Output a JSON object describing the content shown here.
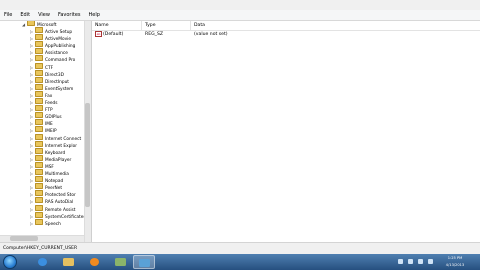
{
  "menu": [
    "File",
    "Edit",
    "View",
    "Favorites",
    "Help"
  ],
  "tree": {
    "root": "Microsoft",
    "items": [
      "Active Setup",
      "ActiveMovie",
      "AppPublishing",
      "Assistance",
      "Command Pro",
      "CTF",
      "Direct3D",
      "DirectInput",
      "EventSystem",
      "Fax",
      "Feeds",
      "FTP",
      "GDIPlus",
      "IME",
      "IMEIP",
      "Internet Connect",
      "Internet Explor",
      "Keyboard",
      "MediaPlayer",
      "MSF",
      "Multimedia",
      "Notepad",
      "PeerNet",
      "Protected Stor",
      "RAS AutoDial",
      "Remote Assist",
      "SystemCertificates",
      "Speech"
    ]
  },
  "list": {
    "columns": [
      "Name",
      "Type",
      "Data"
    ],
    "rows": [
      {
        "name": "(Default)",
        "type": "REG_SZ",
        "data": "(value not set)"
      }
    ]
  },
  "status": "Computer\\HKEY_CURRENT_USER",
  "clock": {
    "time": "1:25 PM",
    "date": "4/13/2013"
  },
  "colors": {
    "taskbar": "#264f7f",
    "folder": "#e9c65c"
  }
}
